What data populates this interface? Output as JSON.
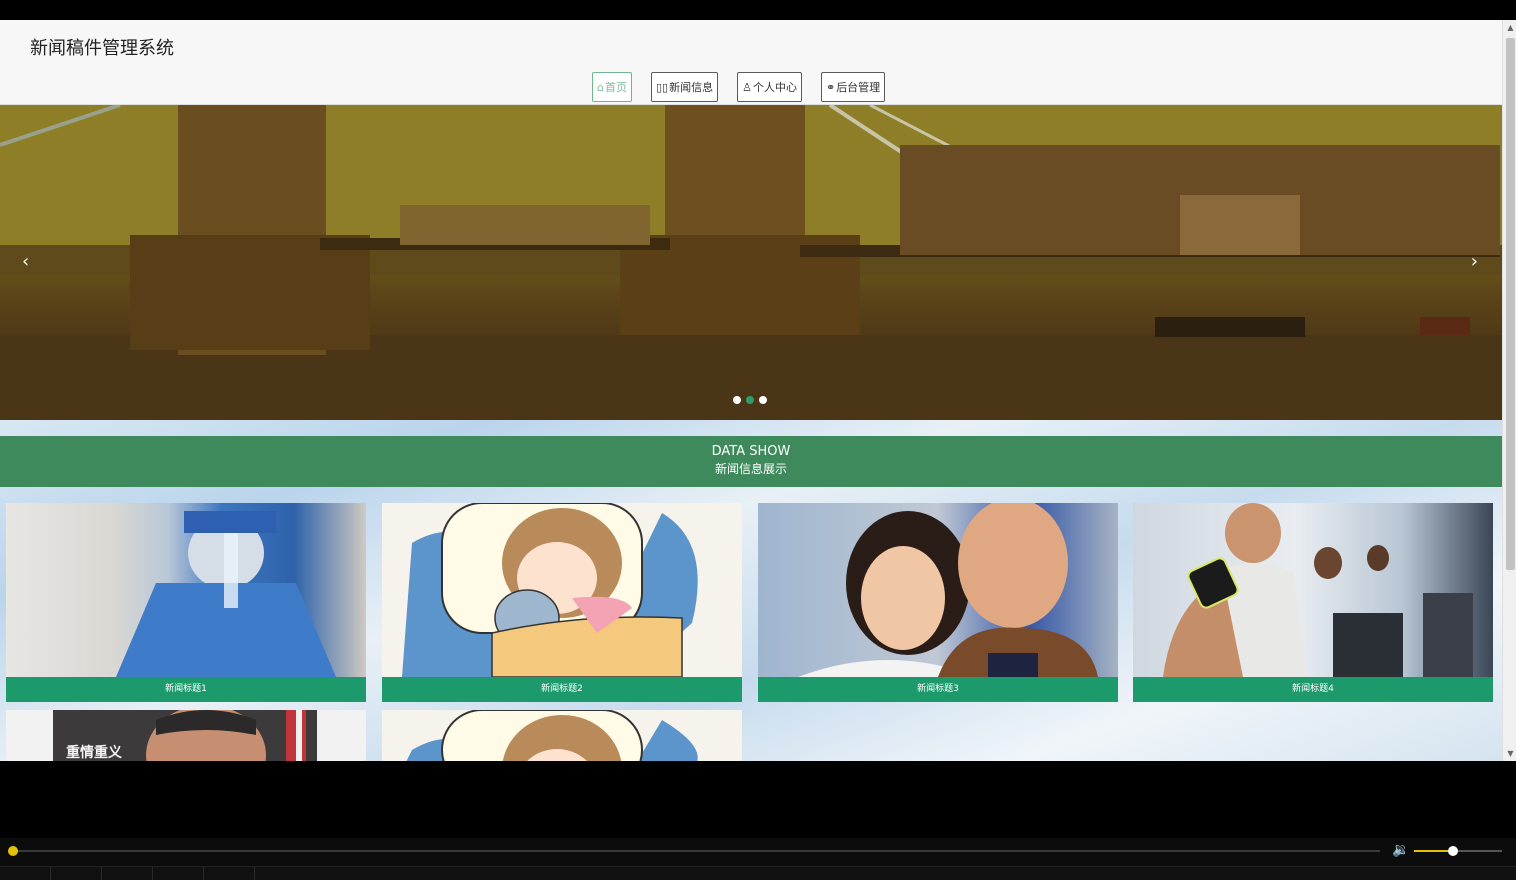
{
  "site": {
    "title": "新闻稿件管理系统"
  },
  "nav": [
    {
      "icon": "home-icon",
      "glyph": "⌂",
      "label": "首页",
      "active": true
    },
    {
      "icon": "news-icon",
      "glyph": "▯▯",
      "label": "新闻信息",
      "active": false
    },
    {
      "icon": "user-icon",
      "glyph": "♙",
      "label": "个人中心",
      "active": false
    },
    {
      "icon": "link-icon",
      "glyph": "⚭",
      "label": "后台管理",
      "active": false
    }
  ],
  "carousel": {
    "prev": "‹",
    "next": "›",
    "slide_count": 3,
    "active_index": 1
  },
  "section": {
    "title_en": "DATA SHOW",
    "title_cn": "新闻信息展示"
  },
  "news": [
    {
      "caption": "新闻标题1"
    },
    {
      "caption": "新闻标题2"
    },
    {
      "caption": "新闻标题3"
    },
    {
      "caption": "新闻标题4"
    },
    {
      "caption": "",
      "image_text": "重情重义"
    },
    {
      "caption": ""
    }
  ],
  "colors": {
    "accent": "#3f8a5d",
    "caption": "#1d9a6c",
    "player_accent": "#e6c10c"
  },
  "player": {
    "progress": 0.0,
    "volume": 0.44
  }
}
